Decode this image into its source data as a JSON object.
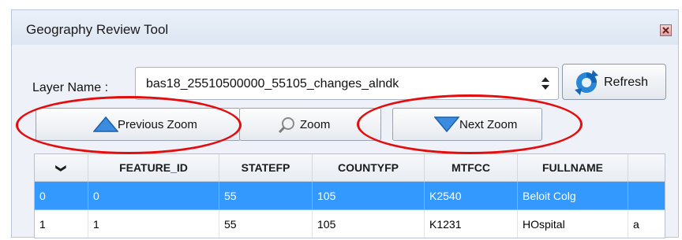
{
  "window": {
    "title": "Geography Review Tool"
  },
  "layer": {
    "label": "Layer Name :",
    "value": "bas18_25510500000_55105_changes_alndk"
  },
  "buttons": {
    "refresh": "Refresh",
    "previous_zoom": "Previous Zoom",
    "zoom": "Zoom",
    "next_zoom": "Next Zoom"
  },
  "table": {
    "sort_glyph": "❯",
    "columns": [
      "FEATURE_ID",
      "STATEFP",
      "COUNTYFP",
      "MTFCC",
      "FULLNAME"
    ],
    "rows": [
      {
        "idx": "0",
        "feature_id": "0",
        "statefp": "55",
        "countyfp": "105",
        "mtfcc": "K2540",
        "fullname": "Beloit Colg",
        "extra": ""
      },
      {
        "idx": "1",
        "feature_id": "1",
        "statefp": "55",
        "countyfp": "105",
        "mtfcc": "K1231",
        "fullname": "HOspital",
        "extra": "a"
      }
    ]
  },
  "colors": {
    "selected_row": "#3399ff",
    "annotation": "#e30d0d"
  }
}
